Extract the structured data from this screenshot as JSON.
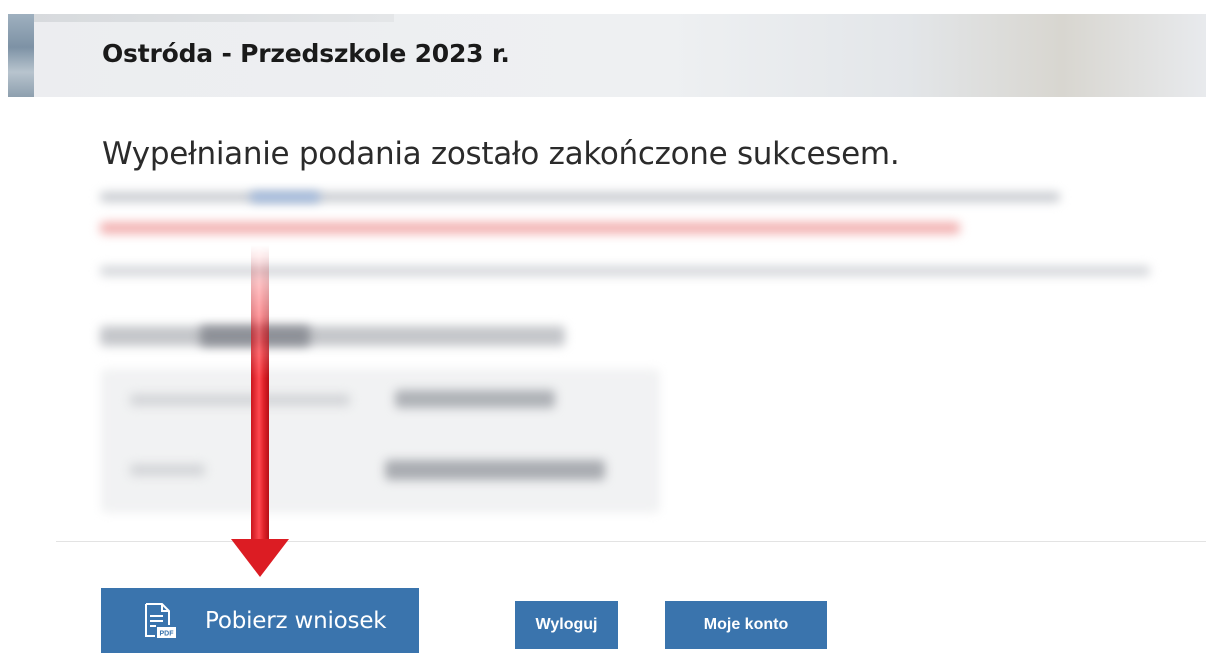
{
  "header": {
    "title": "Ostróda - Przedszkole 2023 r."
  },
  "main": {
    "success_message": "Wypełnianie podania zostało zakończone sukcesem."
  },
  "actions": {
    "download_label": "Pobierz wniosek",
    "download_icon": "pdf-document-icon",
    "logout_label": "Wyloguj",
    "account_label": "Moje konto"
  },
  "annotation": {
    "arrow_icon": "red-arrow-down-icon",
    "arrow_color": "#dc1c23"
  },
  "colors": {
    "button_bg": "#3a74ad",
    "button_text": "#ffffff"
  }
}
